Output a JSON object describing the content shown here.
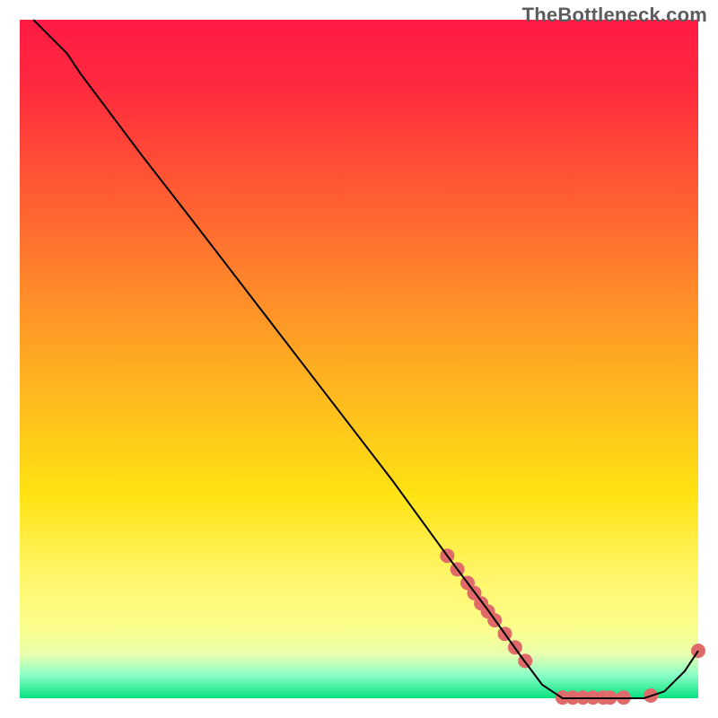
{
  "watermark": "TheBottleneck.com",
  "chart_data": {
    "type": "line",
    "title": "",
    "xlabel": "",
    "ylabel": "",
    "xlim": [
      0,
      100
    ],
    "ylim": [
      0,
      100
    ],
    "grid": false,
    "legend": false,
    "gradient": {
      "stops": [
        {
          "offset": 0.0,
          "color": "#ff1a44"
        },
        {
          "offset": 0.1,
          "color": "#ff2a3e"
        },
        {
          "offset": 0.25,
          "color": "#ff5a33"
        },
        {
          "offset": 0.4,
          "color": "#ff8a2a"
        },
        {
          "offset": 0.55,
          "color": "#ffb91f"
        },
        {
          "offset": 0.7,
          "color": "#ffe312"
        },
        {
          "offset": 0.82,
          "color": "#fff66a"
        },
        {
          "offset": 0.9,
          "color": "#fbff8e"
        },
        {
          "offset": 0.935,
          "color": "#e9ffae"
        },
        {
          "offset": 0.965,
          "color": "#8dffc8"
        },
        {
          "offset": 1.0,
          "color": "#07e27f"
        }
      ]
    },
    "series": [
      {
        "name": "bottleneck-curve",
        "color": "#000000",
        "x": [
          2,
          4,
          7,
          9,
          12,
          18,
          25,
          35,
          45,
          55,
          63,
          69,
          74,
          77,
          80,
          83,
          86,
          89,
          92,
          95,
          98,
          100
        ],
        "y": [
          100,
          98,
          95,
          92,
          88,
          80,
          71,
          58,
          45,
          32,
          21,
          13,
          6,
          2,
          0,
          0,
          0,
          0,
          0,
          1,
          4,
          7
        ]
      }
    ],
    "markers": {
      "name": "highlight-points",
      "color": "#e06a6a",
      "radius": 8,
      "points": [
        {
          "x": 63,
          "y": 21
        },
        {
          "x": 64.5,
          "y": 19
        },
        {
          "x": 66,
          "y": 17
        },
        {
          "x": 67,
          "y": 15.5
        },
        {
          "x": 68,
          "y": 14
        },
        {
          "x": 69,
          "y": 12.8
        },
        {
          "x": 70,
          "y": 11.5
        },
        {
          "x": 71.5,
          "y": 9.5
        },
        {
          "x": 73,
          "y": 7.5
        },
        {
          "x": 74.5,
          "y": 5.5
        },
        {
          "x": 80,
          "y": 0.1
        },
        {
          "x": 81.5,
          "y": 0.1
        },
        {
          "x": 83,
          "y": 0.1
        },
        {
          "x": 84.5,
          "y": 0.1
        },
        {
          "x": 86,
          "y": 0.1
        },
        {
          "x": 87,
          "y": 0.1
        },
        {
          "x": 89,
          "y": 0.1
        },
        {
          "x": 93,
          "y": 0.4
        },
        {
          "x": 100,
          "y": 7
        }
      ]
    }
  }
}
